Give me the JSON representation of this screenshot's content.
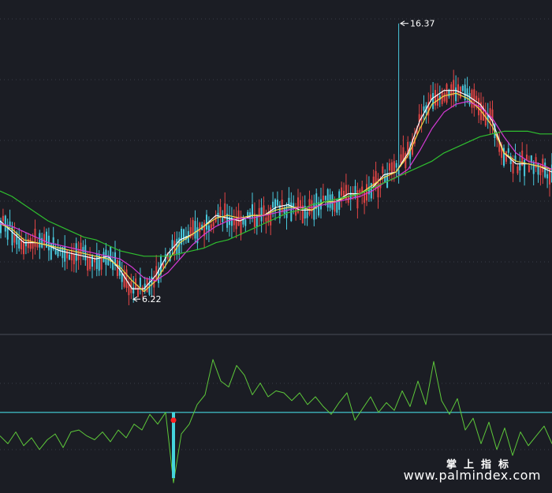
{
  "colors": {
    "background": "#1b1d24",
    "grid": "#3a3d48",
    "divider": "#4a4d57",
    "up_candle": "#e04545",
    "down_candle": "#49c9dd",
    "ma_short": "#ffffff",
    "ma_mid": "#f1d948",
    "ma_long": "#d63ad6",
    "ma_slow": "#2fbf2f",
    "indicator_line": "#5dc83a",
    "indicator_zero": "#45d4dd",
    "signal_marker": "#ff2020",
    "annotation": "#ffffff"
  },
  "chart_data": [
    {
      "type": "candlestick",
      "panel": "price",
      "price_range": [
        5.5,
        17.0
      ],
      "annotations": {
        "high_label": "16.37",
        "low_label": "6.22"
      },
      "series": [
        {
          "name": "",
          "color_key": "ma_short",
          "values": [
            9.1,
            8.7,
            8.3,
            8.3,
            8.2,
            8.0,
            7.9,
            7.8,
            7.7,
            7.8,
            7.3,
            6.6,
            6.6,
            7.1,
            7.9,
            8.4,
            8.6,
            8.9,
            9.3,
            9.2,
            9.1,
            9.3,
            9.3,
            9.6,
            9.7,
            9.5,
            9.5,
            9.8,
            9.8,
            10.1,
            10.1,
            10.3,
            10.8,
            10.9,
            11.6,
            12.8,
            13.6,
            13.9,
            13.9,
            13.7,
            13.4,
            12.8,
            11.6,
            11.2,
            11.2,
            11.1,
            10.9
          ]
        },
        {
          "name": "",
          "color_key": "ma_mid",
          "values": [
            9.0,
            8.8,
            8.4,
            8.3,
            8.2,
            8.1,
            8.0,
            7.9,
            7.8,
            7.7,
            7.4,
            6.9,
            6.5,
            6.9,
            7.6,
            8.3,
            8.6,
            8.9,
            9.2,
            9.3,
            9.2,
            9.3,
            9.3,
            9.5,
            9.6,
            9.6,
            9.5,
            9.8,
            9.8,
            10.0,
            10.1,
            10.4,
            10.7,
            10.9,
            11.5,
            12.5,
            13.4,
            13.7,
            13.8,
            13.6,
            13.2,
            12.6,
            11.6,
            11.3,
            11.2,
            11.1,
            11.0
          ]
        },
        {
          "name": "",
          "color_key": "ma_long",
          "values": [
            9.0,
            8.9,
            8.7,
            8.5,
            8.3,
            8.2,
            8.1,
            8.0,
            7.9,
            7.8,
            7.7,
            7.4,
            7.0,
            6.9,
            7.2,
            7.7,
            8.2,
            8.6,
            8.9,
            9.1,
            9.2,
            9.2,
            9.3,
            9.4,
            9.5,
            9.6,
            9.6,
            9.7,
            9.8,
            9.9,
            10.0,
            10.2,
            10.5,
            10.7,
            11.0,
            11.7,
            12.5,
            13.1,
            13.4,
            13.5,
            13.3,
            12.9,
            12.2,
            11.6,
            11.3,
            11.2,
            11.0
          ]
        },
        {
          "name": "",
          "color_key": "ma_slow",
          "values": [
            10.2,
            10.0,
            9.7,
            9.4,
            9.1,
            8.9,
            8.7,
            8.5,
            8.4,
            8.2,
            8.0,
            7.9,
            7.8,
            7.8,
            7.8,
            7.9,
            8.0,
            8.1,
            8.3,
            8.4,
            8.6,
            8.8,
            9.0,
            9.2,
            9.4,
            9.5,
            9.7,
            9.8,
            9.9,
            10.0,
            10.1,
            10.3,
            10.5,
            10.7,
            10.9,
            11.1,
            11.3,
            11.6,
            11.8,
            12.0,
            12.2,
            12.3,
            12.4,
            12.4,
            12.4,
            12.3,
            12.3
          ]
        }
      ]
    },
    {
      "type": "line",
      "panel": "indicator",
      "ylim": [
        -4.0,
        3.5
      ],
      "reference_line": 0,
      "series": [
        {
          "name": "",
          "color_key": "indicator_line",
          "values": [
            -1.2,
            -1.6,
            -1.0,
            -1.7,
            -1.3,
            -1.9,
            -1.4,
            -1.1,
            -1.8,
            -1.0,
            -0.9,
            -1.2,
            -1.4,
            -1.0,
            -1.5,
            -0.9,
            -1.3,
            -0.6,
            -0.9,
            -0.1,
            -0.6,
            0.0,
            -3.6,
            -1.1,
            -0.6,
            0.4,
            0.9,
            2.7,
            1.6,
            1.3,
            2.4,
            1.9,
            0.9,
            1.5,
            0.8,
            1.1,
            1.0,
            0.6,
            1.0,
            0.4,
            0.8,
            0.3,
            -0.1,
            0.5,
            1.0,
            -0.4,
            0.2,
            0.8,
            0.0,
            0.5,
            0.1,
            1.1,
            0.3,
            1.6,
            0.4,
            2.6,
            0.6,
            -0.1,
            0.7,
            -0.9,
            -0.3,
            -1.6,
            -0.5,
            -1.9,
            -0.8,
            -2.2,
            -1.0,
            -1.7,
            -1.2,
            -0.7,
            -1.6
          ]
        }
      ],
      "signal_markers": [
        {
          "index": 22,
          "value": -0.4
        }
      ]
    }
  ],
  "watermark": {
    "cn": "掌上指标",
    "url": "www.palmindex.com"
  }
}
